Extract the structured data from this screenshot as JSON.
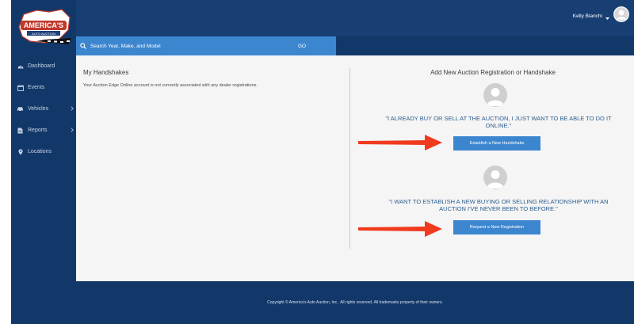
{
  "brand": {
    "logo_text": "AMERICA'S",
    "logo_sub": "AUTO AUCTION"
  },
  "sidebar": {
    "items": [
      {
        "label": "Dashboard",
        "icon": "dashboard-icon",
        "has_submenu": false
      },
      {
        "label": "Events",
        "icon": "calendar-icon",
        "has_submenu": false
      },
      {
        "label": "Vehicles",
        "icon": "car-icon",
        "has_submenu": true
      },
      {
        "label": "Reports",
        "icon": "document-icon",
        "has_submenu": true
      },
      {
        "label": "Locations",
        "icon": "map-marker-icon",
        "has_submenu": false
      }
    ]
  },
  "header": {
    "user_name": "Kelly Bianchi"
  },
  "search": {
    "placeholder": "Search Year, Make, and Model",
    "button_label": "GO"
  },
  "handshakes": {
    "title": "My Handshakes",
    "message": "Your Auction Edge Online account is not currently associated with any dealer registrations."
  },
  "add_new": {
    "title": "Add New Auction Registration or Handshake",
    "options": [
      {
        "quote": "\"I already buy or sell at the auction, I just want to be able to do it online.\"",
        "button_label": "Establish a New Handshake"
      },
      {
        "quote": "\"I want to establish a new buying or selling relationship with an auction I've never been to before.\"",
        "button_label": "Request a New Registration"
      }
    ]
  },
  "footer": {
    "text": "Copyright © America's Auto Auction, Inc.. All rights reserved. All trademarks property of their owners."
  },
  "colors": {
    "sidebar_bg": "#12386a",
    "header_bg": "#173f74",
    "accent": "#3c86d0",
    "quote_text": "#2c5d8e",
    "arrow": "#f03a1e"
  }
}
